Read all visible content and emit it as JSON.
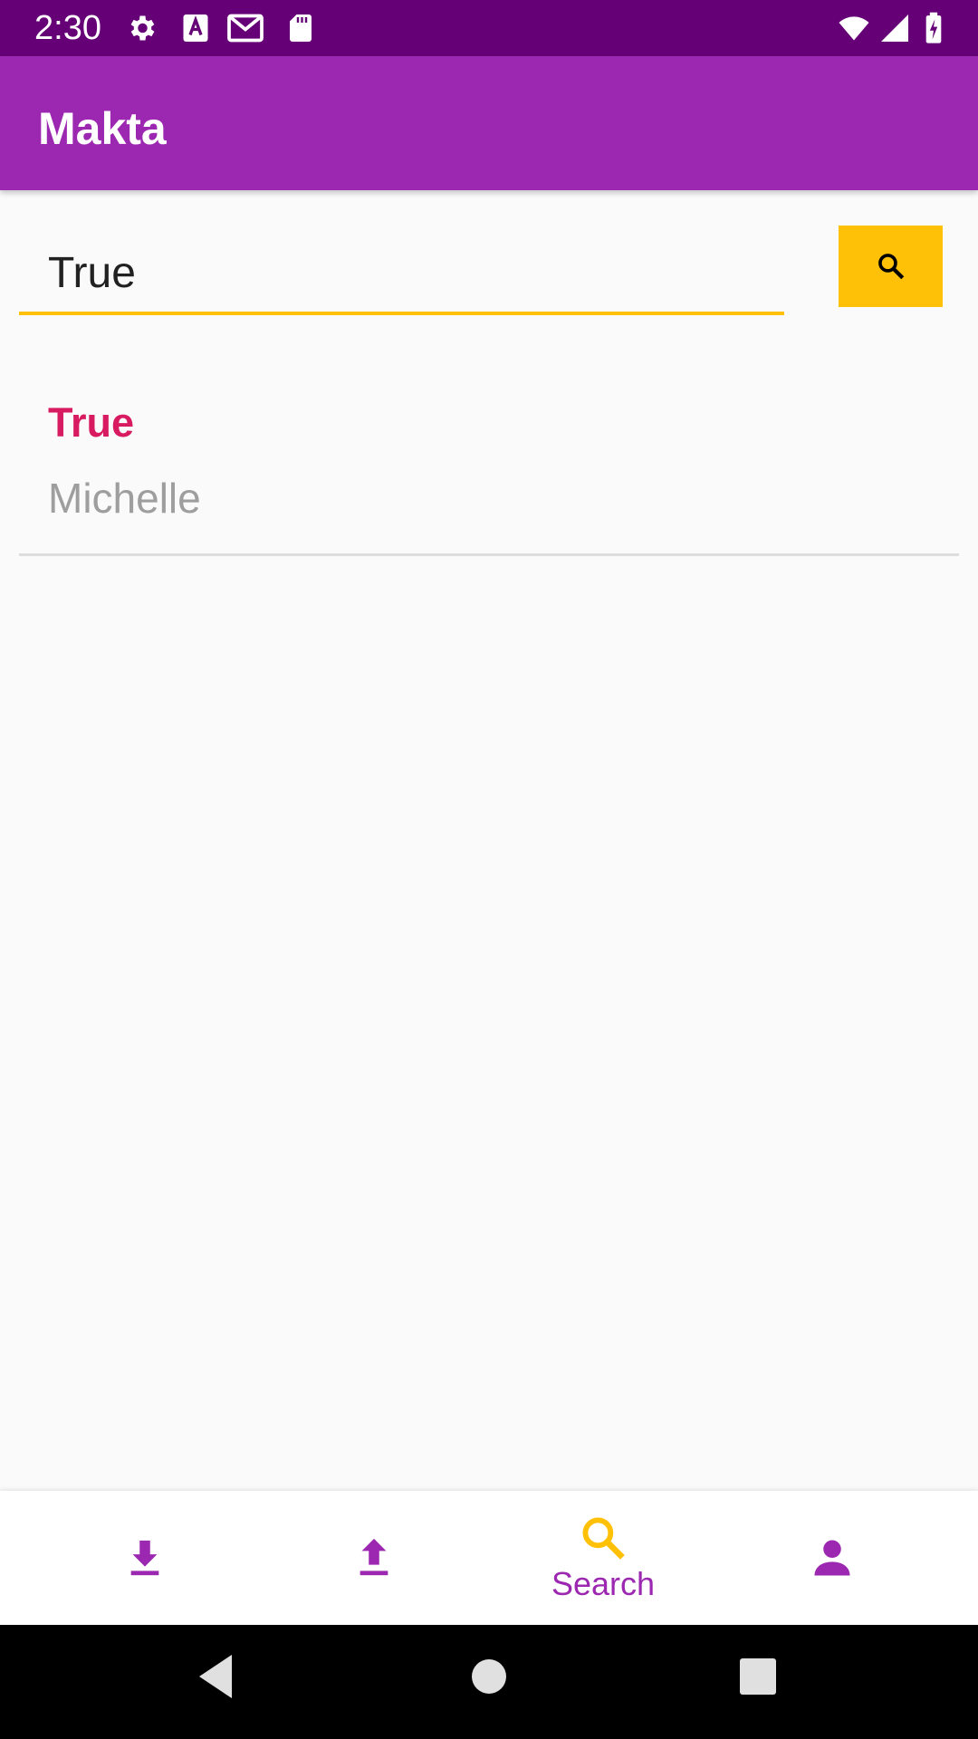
{
  "status_bar": {
    "time": "2:30",
    "icons": [
      "settings-icon",
      "a-notification-icon",
      "gmail-icon",
      "sd-card-icon",
      "wifi-icon",
      "cell-signal-icon",
      "battery-charging-icon"
    ]
  },
  "app_bar": {
    "title": "Makta"
  },
  "search": {
    "value": "True",
    "button_icon": "search-icon"
  },
  "results": [
    {
      "title": "True",
      "subtitle": "Michelle"
    }
  ],
  "bottom_nav": {
    "items": [
      {
        "icon": "download-icon",
        "label": ""
      },
      {
        "icon": "upload-icon",
        "label": ""
      },
      {
        "icon": "search-icon",
        "label": "Search",
        "selected": true
      },
      {
        "icon": "person-icon",
        "label": ""
      }
    ]
  },
  "colors": {
    "status_bar": "#660077",
    "primary": "#9c27b0",
    "accent": "#ffc107",
    "result_title": "#d81b60",
    "subtitle": "#9e9e9e"
  }
}
